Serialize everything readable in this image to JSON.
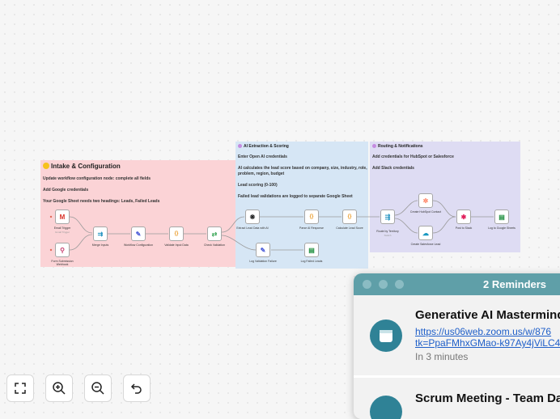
{
  "notes": {
    "intake": {
      "title": "Intake & Configuration",
      "lines": [
        "Update workflow configuration node: complete all fields",
        "Add Google credentials",
        "Your Google Sheet needs two headings: Leads, Failed Leads"
      ]
    },
    "ai": {
      "title": "AI Extraction & Scoring",
      "lines": [
        "Enter Open AI credentials",
        "AI calculates the lead score based on company, size, industry, role,",
        "problem, region, budget",
        "Lead scoring (0-100)",
        "Failed lead validations are logged to separate Google Sheet"
      ]
    },
    "routing": {
      "title": "Routing & Notifications",
      "lines": [
        "Add credentials for HubSpot or Salesforce",
        "Add Slack credentials"
      ]
    }
  },
  "nodes": [
    {
      "name": "email-trigger-node",
      "label": "Email Trigger",
      "sub": "Gmail Trigger",
      "icon": "gmail-icon",
      "glyph": "M",
      "color": "#d93025"
    },
    {
      "name": "form-webhook-node",
      "label": "Form Submission",
      "label2": "Webhook",
      "icon": "webhook-icon",
      "glyph": "⚲",
      "color": "#c53a6b"
    },
    {
      "name": "merge-inputs-node",
      "label": "Merge Inputs",
      "icon": "merge-icon",
      "glyph": "⇉",
      "color": "#1a8fbf"
    },
    {
      "name": "workflow-config-node",
      "label": "Workflow Configuration",
      "icon": "pencil-icon",
      "glyph": "✎",
      "color": "#4a5bd8"
    },
    {
      "name": "validate-input-node",
      "label": "Validate Input Data",
      "icon": "code-icon",
      "glyph": "{}",
      "color": "#e8941a"
    },
    {
      "name": "check-validation-node",
      "label": "Check Validation",
      "icon": "if-icon",
      "glyph": "⇄",
      "color": "#3aa757"
    },
    {
      "name": "extract-lead-node",
      "label": "Extract Lead Data with AI",
      "icon": "openai-icon",
      "glyph": "❋",
      "color": "#222"
    },
    {
      "name": "parse-ai-node",
      "label": "Parse AI Response",
      "icon": "code-icon",
      "glyph": "{}",
      "color": "#e8941a"
    },
    {
      "name": "calc-score-node",
      "label": "Calculate Lead Score",
      "icon": "code-icon",
      "glyph": "{}",
      "color": "#e8941a"
    },
    {
      "name": "log-failure-node",
      "label": "Log Validation Failure",
      "icon": "pencil-icon",
      "glyph": "✎",
      "color": "#4a5bd8"
    },
    {
      "name": "log-failed-leads-node",
      "label": "Log Failed Leads",
      "icon": "sheets-icon",
      "glyph": "▤",
      "color": "#1e8e3e"
    },
    {
      "name": "route-territory-node",
      "label": "Route by Territory",
      "sub": "Switch",
      "icon": "switch-icon",
      "glyph": "⇶",
      "color": "#1a8fbf"
    },
    {
      "name": "hubspot-node",
      "label": "Create HubSpot Contact",
      "icon": "hubspot-icon",
      "glyph": "✲",
      "color": "#ff7a59"
    },
    {
      "name": "salesforce-node",
      "label": "Create Salesforce Lead",
      "icon": "salesforce-icon",
      "glyph": "☁",
      "color": "#1798c1"
    },
    {
      "name": "slack-node",
      "label": "Post to Slack",
      "icon": "slack-icon",
      "glyph": "✱",
      "color": "#e01e5a"
    },
    {
      "name": "sheets-log-node",
      "label": "Log to Google Sheets",
      "icon": "sheets-icon",
      "glyph": "▤",
      "color": "#1e8e3e"
    }
  ],
  "reminders": {
    "title": "2 Reminders",
    "items": [
      {
        "name": "Generative AI Mastermind",
        "link_line1": "https://us06web.zoom.us/w/876",
        "link_line2": "tk=PpaFMhxGMao-k97Ay4jViLC4",
        "time": "In 3 minutes"
      },
      {
        "name": "Scrum Meeting - Team Dai"
      }
    ]
  },
  "controls": {
    "fit": "fit-view-icon",
    "zoom_in": "zoom-in-icon",
    "zoom_out": "zoom-out-icon",
    "undo": "undo-icon"
  }
}
